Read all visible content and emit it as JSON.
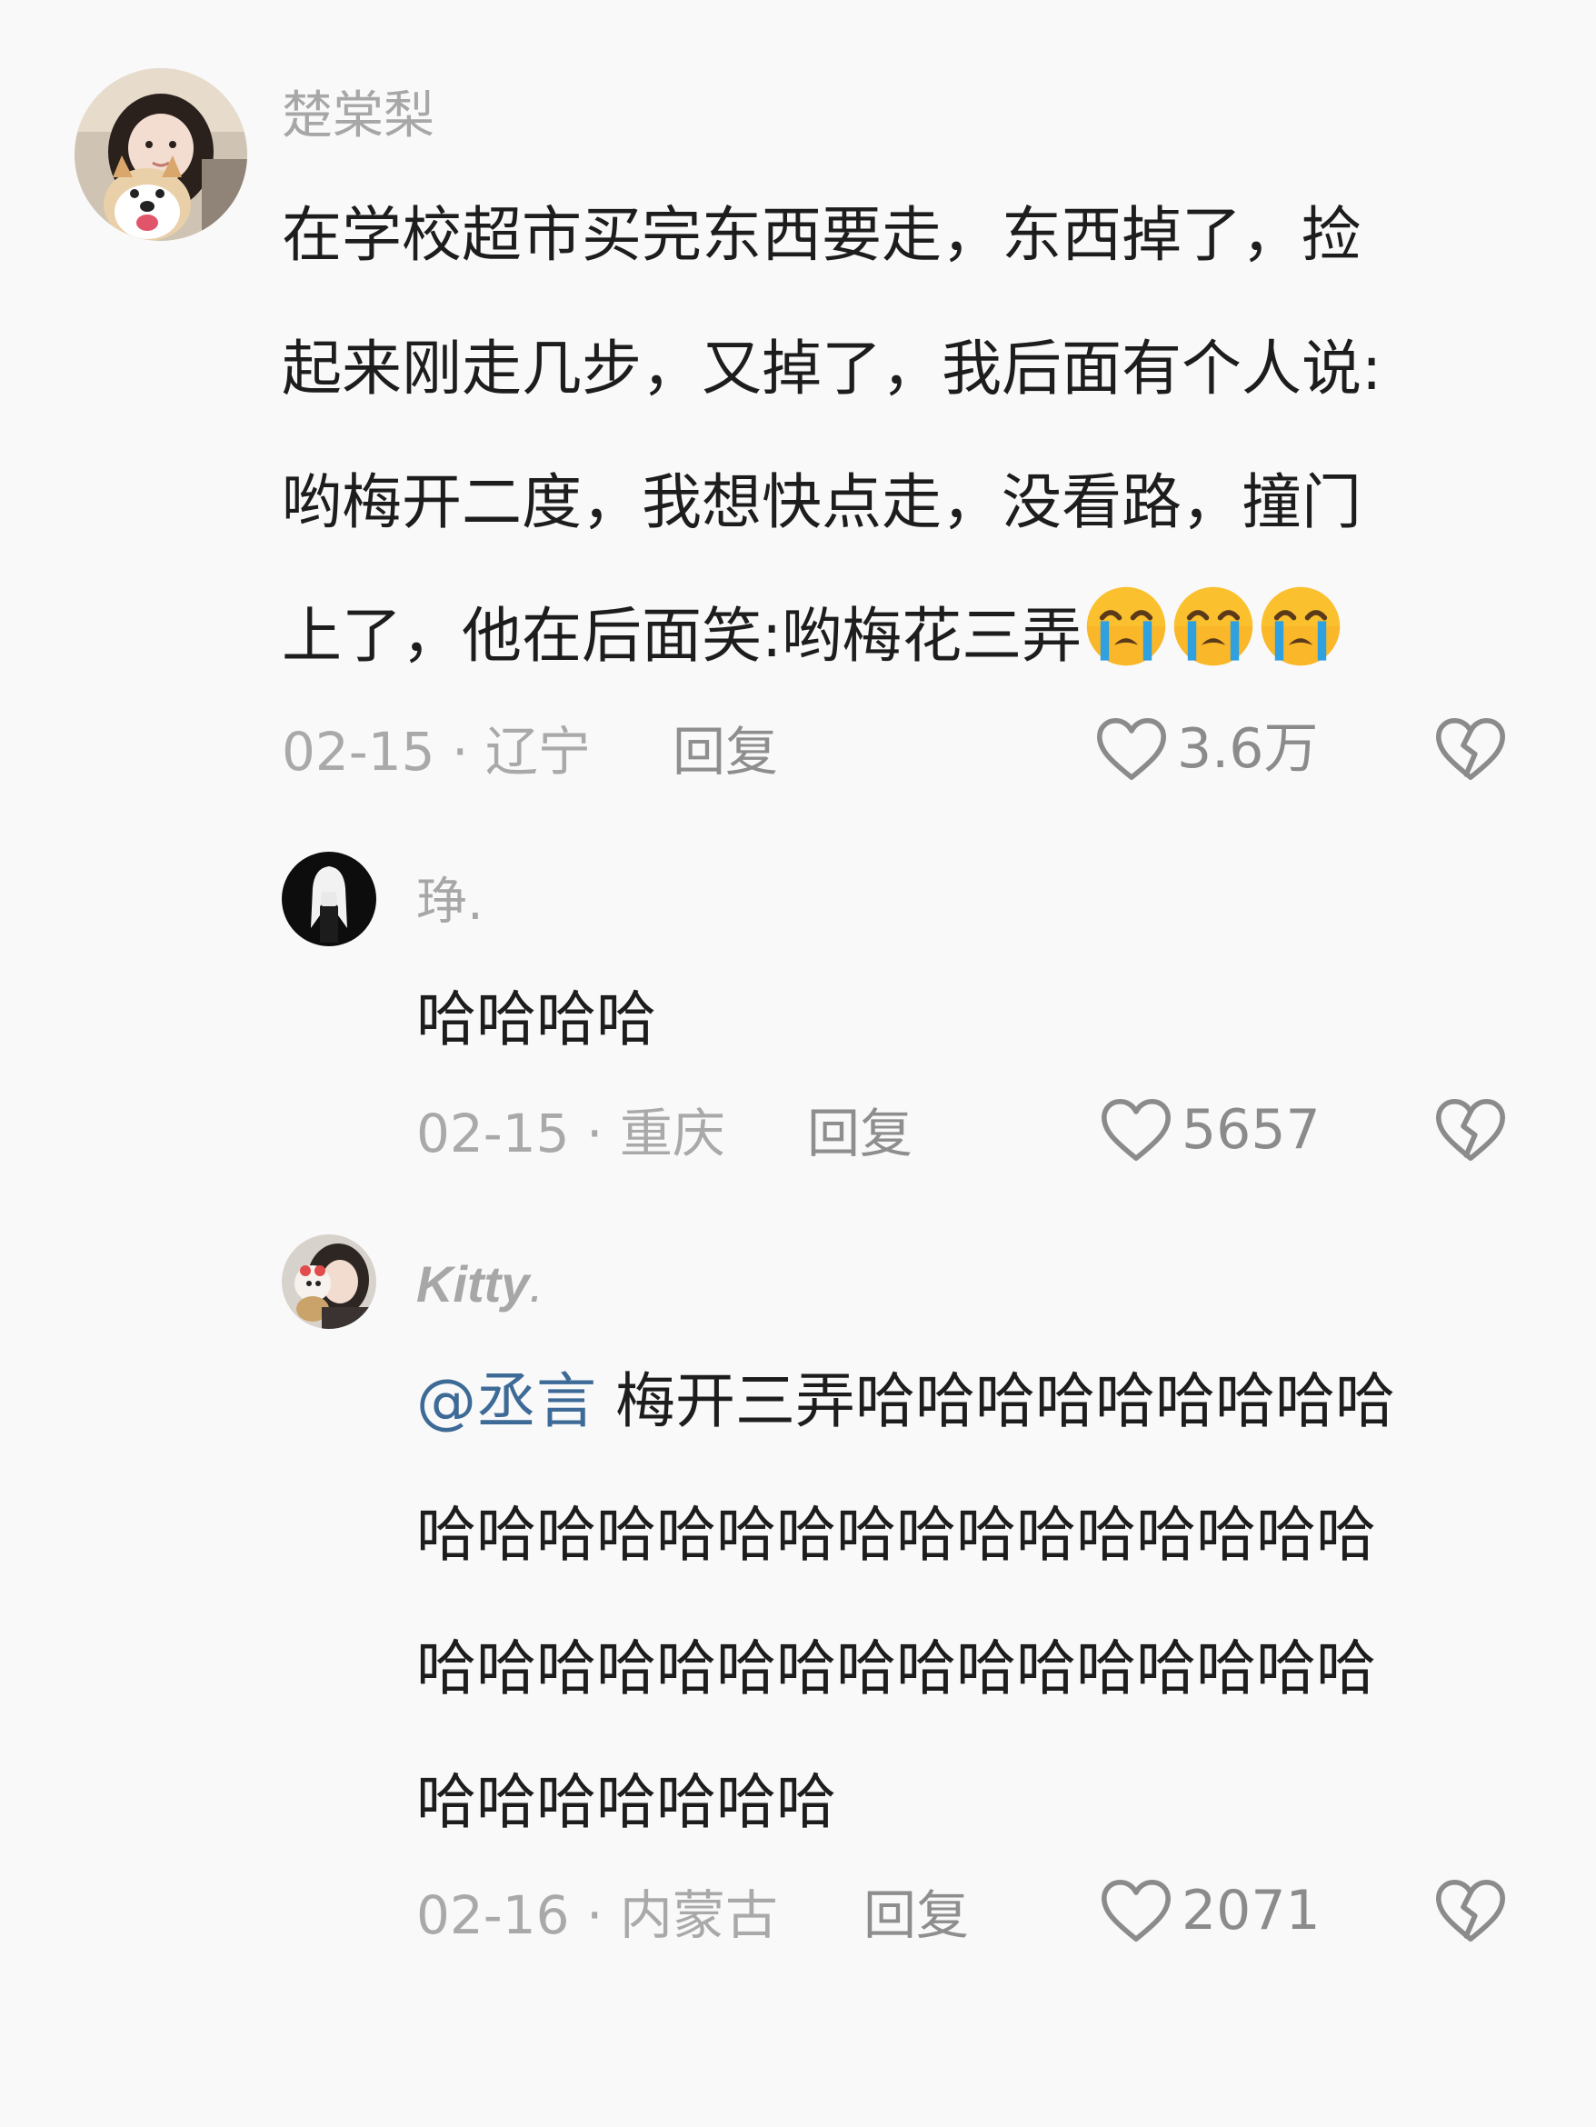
{
  "comments": [
    {
      "username": "楚棠梨",
      "avatar_icon": "girl-with-shiba-dog-avatar",
      "lines": [
        "在学校超市买完东西要走，东西掉了，捡",
        "起来刚走几步，又掉了，我后面有个人说:",
        "哟梅开二度，我想快点走，没看路，撞门",
        "上了，他在后面笑:哟梅花三弄"
      ],
      "emoji": [
        "loudly-crying-face",
        "loudly-crying-face",
        "loudly-crying-face"
      ],
      "date": "02-15",
      "location": "辽宁",
      "reply_label": "回复",
      "likes": "3.6万",
      "like_icon": "heart-outline-icon",
      "dislike_icon": "broken-heart-icon"
    },
    {
      "username": "琤.",
      "avatar_icon": "dark-figure-avatar",
      "lines": [
        "哈哈哈哈"
      ],
      "date": "02-15",
      "location": "重庆",
      "reply_label": "回复",
      "likes": "5657",
      "like_icon": "heart-outline-icon",
      "dislike_icon": "broken-heart-icon"
    },
    {
      "username": "Kitty",
      "username_suffix": ".",
      "avatar_icon": "girl-with-plush-toy-avatar",
      "mention": "@丞言",
      "lines": [
        "梅开三弄哈哈哈哈哈哈哈哈哈",
        "哈哈哈哈哈哈哈哈哈哈哈哈哈哈哈哈",
        "哈哈哈哈哈哈哈哈哈哈哈哈哈哈哈哈",
        "哈哈哈哈哈哈哈"
      ],
      "date": "02-16",
      "location": "内蒙古",
      "reply_label": "回复",
      "likes": "2071",
      "like_icon": "heart-outline-icon",
      "dislike_icon": "broken-heart-icon"
    }
  ],
  "meta_separator": " · ",
  "colors": {
    "background": "#f9f9f9",
    "text": "#1d1d1d",
    "muted": "#a9a9a9",
    "mention": "#3d6a96",
    "emoji_face": "#fbc02d",
    "emoji_tears": "#2fa0e0"
  }
}
